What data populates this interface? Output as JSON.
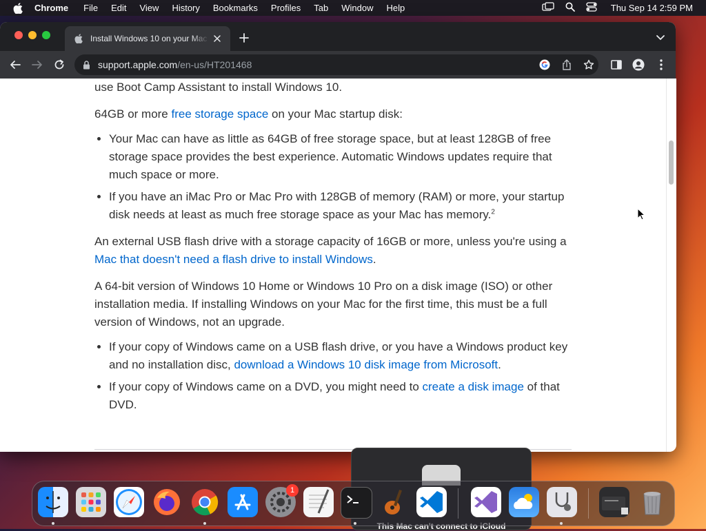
{
  "menubar": {
    "app_name": "Chrome",
    "items": [
      "File",
      "Edit",
      "View",
      "History",
      "Bookmarks",
      "Profiles",
      "Tab",
      "Window",
      "Help"
    ],
    "clock": "Thu Sep 14  2:59 PM"
  },
  "browser": {
    "tab_title": "Install Windows 10 on your Mac",
    "url_host": "support.apple.com",
    "url_path": "/en-us/HT201468"
  },
  "article": {
    "p0": "use Boot Camp Assistant to install Windows 10.",
    "p1_prefix": "64GB or more ",
    "p1_link": "free storage space",
    "p1_suffix": " on your Mac startup disk:",
    "bullet1": "Your Mac can have as little as 64GB of free storage space, but at least 128GB of free storage space provides the best experience. Automatic Windows updates require that much space or more.",
    "bullet2": "If you have an iMac Pro or Mac Pro with 128GB of memory (RAM) or more, your startup disk needs at least as much free storage space as your Mac has memory.",
    "bullet2_sup": "2",
    "p2_prefix": "An external USB flash drive with a storage capacity of 16GB or more, unless you're using a ",
    "p2_link": "Mac that doesn't need a flash drive to install Windows",
    "p2_suffix": ".",
    "p3": "A 64-bit version of Windows 10 Home or Windows 10 Pro on a disk image (ISO) or other installation media. If installing Windows on your Mac for the first time, this must be a full version of Windows, not an upgrade.",
    "bullet3_prefix": "If your copy of Windows came on a USB flash drive, or you have a Windows product key and no installation disc, ",
    "bullet3_link": "download a Windows 10 disk image from Microsoft",
    "bullet3_suffix": ".",
    "bullet4_prefix": "If your copy of Windows came on a DVD, you might need to ",
    "bullet4_link": "create a disk image",
    "bullet4_suffix": " of that DVD."
  },
  "popup": {
    "message": "This Mac can't connect to iCloud"
  },
  "dock": {
    "settings_badge": "1",
    "apps": [
      "finder-icon",
      "launchpad-icon",
      "safari-icon",
      "firefox-icon",
      "chrome-icon",
      "app-store-icon",
      "system-settings-icon",
      "textedit-icon",
      "terminal-icon",
      "garageband-icon",
      "vscode-icon",
      "visual-studio-icon",
      "icloud-icon",
      "disk-utility-icon",
      "screenshot-icon",
      "trash-icon"
    ]
  },
  "colors": {
    "link": "#0066cc",
    "browser_chrome": "#35363a",
    "tabstrip": "#202124"
  }
}
